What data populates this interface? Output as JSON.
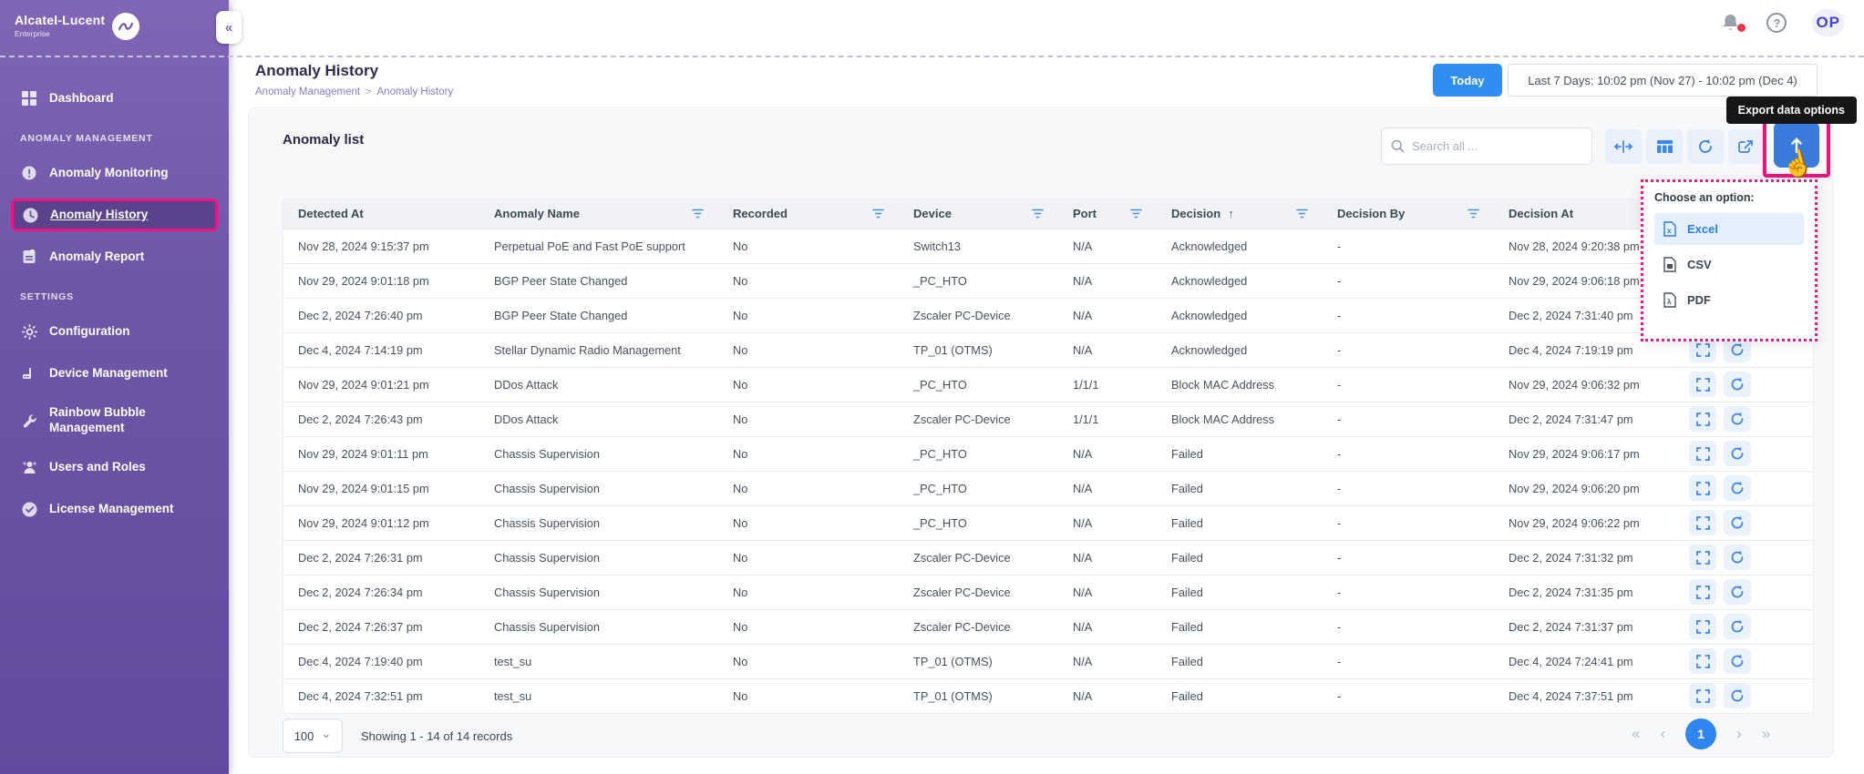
{
  "brand": {
    "name": "Alcatel-Lucent",
    "sub": "Enterprise"
  },
  "topbar": {
    "avatar_initials": "OP"
  },
  "icons": {
    "collapse": "«",
    "help": "?",
    "chevron_down": "⌄",
    "sort_asc": "↑",
    "cursor_hand": "☝",
    "first": "«",
    "prev": "‹",
    "next": "›",
    "last": "»",
    "breadcrumb_sep": ">"
  },
  "sidebar": {
    "sections": [
      {
        "label": "ANOMALY MANAGEMENT"
      },
      {
        "label": "SETTINGS"
      }
    ],
    "items": [
      {
        "label": "Dashboard"
      },
      {
        "label": "Anomaly Monitoring"
      },
      {
        "label": "Anomaly History",
        "active": true
      },
      {
        "label": "Anomaly Report"
      },
      {
        "label": "Configuration"
      },
      {
        "label": "Device Management"
      },
      {
        "label": "Rainbow Bubble Management"
      },
      {
        "label": "Users and Roles"
      },
      {
        "label": "License Management"
      }
    ]
  },
  "header": {
    "title": "Anomaly History",
    "breadcrumb": [
      "Anomaly Management",
      "Anomaly History"
    ],
    "today_button": "Today",
    "date_range": "Last 7 Days: 10:02 pm (Nov 27) - 10:02 pm (Dec 4)"
  },
  "tooltip": "Export data options",
  "list": {
    "title": "Anomaly list",
    "search_placeholder": "Search all ...",
    "export_menu": {
      "title": "Choose an option:",
      "options": [
        "Excel",
        "CSV",
        "PDF"
      ]
    }
  },
  "table": {
    "columns": [
      "Detected At",
      "Anomaly Name",
      "Recorded",
      "Device",
      "Port",
      "Decision",
      "Decision By",
      "Decision At"
    ],
    "sorted_column": "Decision",
    "sort_direction": "asc",
    "rows": [
      {
        "detected_at": "Nov 28, 2024 9:15:37 pm",
        "name": "Perpetual PoE and Fast PoE support",
        "recorded": "No",
        "device": "Switch13",
        "port": "N/A",
        "decision": "Acknowledged",
        "decision_by": "-",
        "decision_at": "Nov 28, 2024 9:20:38 pm"
      },
      {
        "detected_at": "Nov 29, 2024 9:01:18 pm",
        "name": "BGP Peer State Changed",
        "recorded": "No",
        "device": "_PC_HTO",
        "port": "N/A",
        "decision": "Acknowledged",
        "decision_by": "-",
        "decision_at": "Nov 29, 2024 9:06:18 pm"
      },
      {
        "detected_at": "Dec 2, 2024 7:26:40 pm",
        "name": "BGP Peer State Changed",
        "recorded": "No",
        "device": "Zscaler PC-Device",
        "port": "N/A",
        "decision": "Acknowledged",
        "decision_by": "-",
        "decision_at": "Dec 2, 2024 7:31:40 pm"
      },
      {
        "detected_at": "Dec 4, 2024 7:14:19 pm",
        "name": "Stellar Dynamic Radio Management",
        "recorded": "No",
        "device": "TP_01 (OTMS)",
        "port": "N/A",
        "decision": "Acknowledged",
        "decision_by": "-",
        "decision_at": "Dec 4, 2024 7:19:19 pm"
      },
      {
        "detected_at": "Nov 29, 2024 9:01:21 pm",
        "name": "DDos Attack",
        "recorded": "No",
        "device": "_PC_HTO",
        "port": "1/1/1",
        "decision": "Block MAC Address",
        "decision_by": "-",
        "decision_at": "Nov 29, 2024 9:06:32 pm"
      },
      {
        "detected_at": "Dec 2, 2024 7:26:43 pm",
        "name": "DDos Attack",
        "recorded": "No",
        "device": "Zscaler PC-Device",
        "port": "1/1/1",
        "decision": "Block MAC Address",
        "decision_by": "-",
        "decision_at": "Dec 2, 2024 7:31:47 pm"
      },
      {
        "detected_at": "Nov 29, 2024 9:01:11 pm",
        "name": "Chassis Supervision",
        "recorded": "No",
        "device": "_PC_HTO",
        "port": "N/A",
        "decision": "Failed",
        "decision_by": "-",
        "decision_at": "Nov 29, 2024 9:06:17 pm"
      },
      {
        "detected_at": "Nov 29, 2024 9:01:15 pm",
        "name": "Chassis Supervision",
        "recorded": "No",
        "device": "_PC_HTO",
        "port": "N/A",
        "decision": "Failed",
        "decision_by": "-",
        "decision_at": "Nov 29, 2024 9:06:20 pm"
      },
      {
        "detected_at": "Nov 29, 2024 9:01:12 pm",
        "name": "Chassis Supervision",
        "recorded": "No",
        "device": "_PC_HTO",
        "port": "N/A",
        "decision": "Failed",
        "decision_by": "-",
        "decision_at": "Nov 29, 2024 9:06:22 pm"
      },
      {
        "detected_at": "Dec 2, 2024 7:26:31 pm",
        "name": "Chassis Supervision",
        "recorded": "No",
        "device": "Zscaler PC-Device",
        "port": "N/A",
        "decision": "Failed",
        "decision_by": "-",
        "decision_at": "Dec 2, 2024 7:31:32 pm"
      },
      {
        "detected_at": "Dec 2, 2024 7:26:34 pm",
        "name": "Chassis Supervision",
        "recorded": "No",
        "device": "Zscaler PC-Device",
        "port": "N/A",
        "decision": "Failed",
        "decision_by": "-",
        "decision_at": "Dec 2, 2024 7:31:35 pm"
      },
      {
        "detected_at": "Dec 2, 2024 7:26:37 pm",
        "name": "Chassis Supervision",
        "recorded": "No",
        "device": "Zscaler PC-Device",
        "port": "N/A",
        "decision": "Failed",
        "decision_by": "-",
        "decision_at": "Dec 2, 2024 7:31:37 pm"
      },
      {
        "detected_at": "Dec 4, 2024 7:19:40 pm",
        "name": "test_su",
        "recorded": "No",
        "device": "TP_01 (OTMS)",
        "port": "N/A",
        "decision": "Failed",
        "decision_by": "-",
        "decision_at": "Dec 4, 2024 7:24:41 pm"
      },
      {
        "detected_at": "Dec 4, 2024 7:32:51 pm",
        "name": "test_su",
        "recorded": "No",
        "device": "TP_01 (OTMS)",
        "port": "N/A",
        "decision": "Failed",
        "decision_by": "-",
        "decision_at": "Dec 4, 2024 7:37:51 pm"
      }
    ]
  },
  "footer": {
    "page_size": "100",
    "showing": "Showing 1 - 14 of 14 records",
    "current_page": "1"
  },
  "colors": {
    "brand_pink": "#ed147f",
    "accent_blue": "#2f86f0",
    "sidebar_purple": "#6f57a8",
    "export_button_blue": "#3b7bdb"
  }
}
